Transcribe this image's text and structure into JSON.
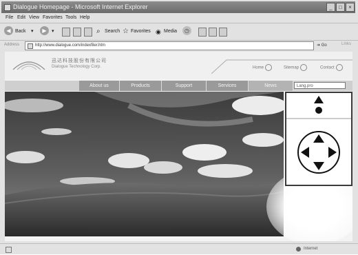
{
  "window": {
    "title": "Dialogue Homepage - Microsoft Internet Explorer",
    "minimize": "_",
    "maximize": "□",
    "close": "×"
  },
  "menu": [
    "File",
    "Edit",
    "View",
    "Favorites",
    "Tools",
    "Help"
  ],
  "toolbar": {
    "back": "Back",
    "search": "Search",
    "favorites": "Favorites",
    "media": "Media"
  },
  "address": {
    "label": "Address",
    "url": "http://www.dialogue.com/indexfiler.htm",
    "go": "Go",
    "links": "Links"
  },
  "site": {
    "company_cn": "迅达科技股份有限公司",
    "company_en": "Dialogue Technology Corp.",
    "top_links": [
      "Home",
      "Sitemap",
      "Contact"
    ],
    "nav": [
      "About us",
      "Products",
      "Support",
      "Services",
      "News"
    ],
    "search_value": "Lang.pro"
  },
  "ptz": {
    "icons": [
      "up-arrow-icon",
      "dot-icon",
      "dpad-up-icon",
      "dpad-down-icon",
      "dpad-left-icon",
      "dpad-right-icon"
    ]
  },
  "status": {
    "zone": "Internet"
  },
  "colors": {
    "titlebar": "#7a7a7a",
    "nav": "#9a9a9a",
    "panel_border": "#3a3a3a"
  }
}
